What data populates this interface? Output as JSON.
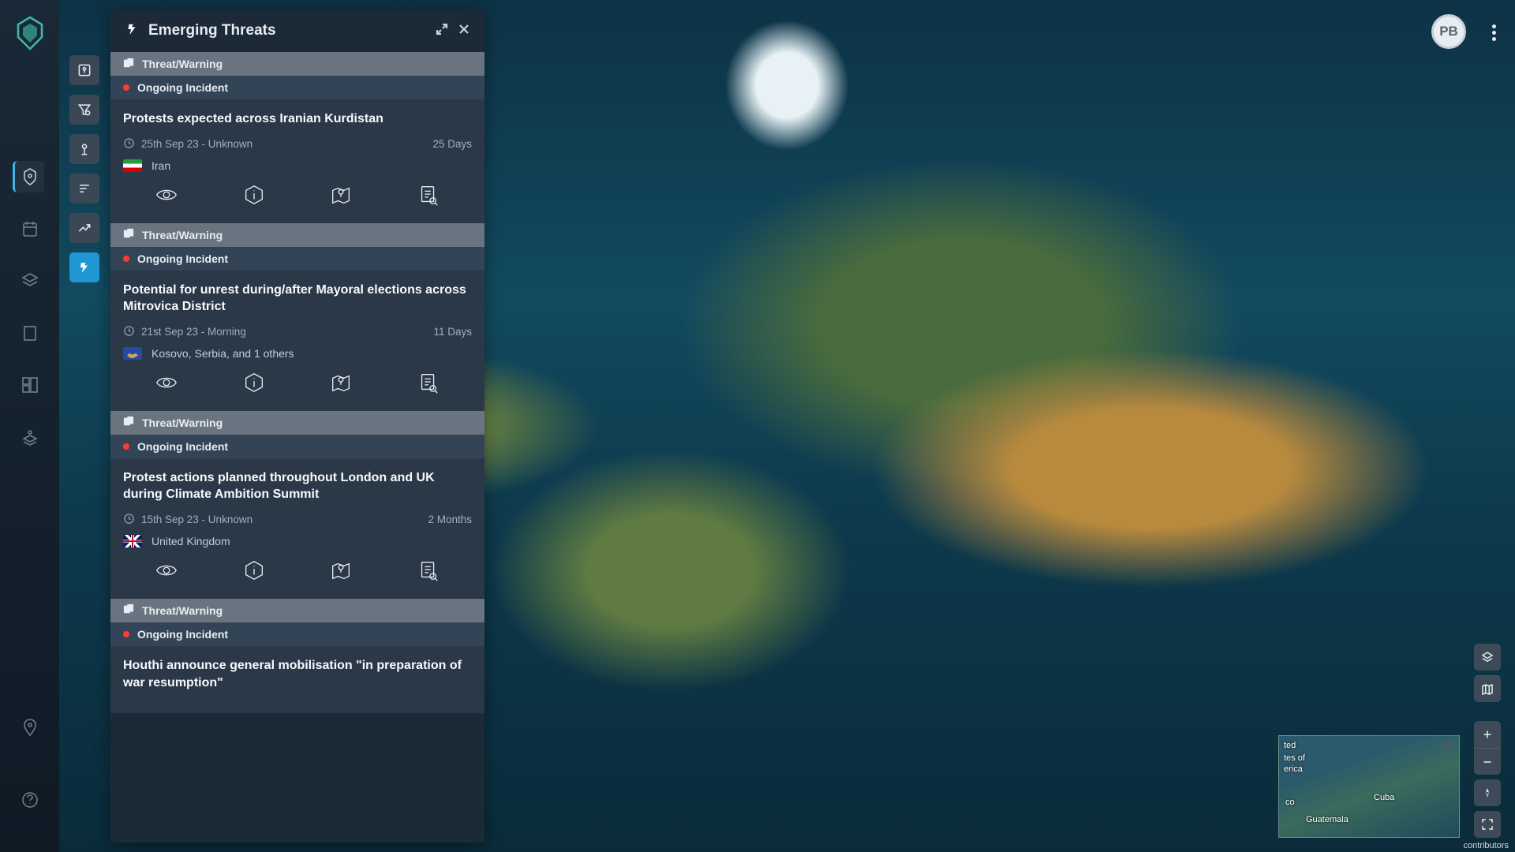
{
  "header": {
    "title": "Emerging Threats",
    "user_initials": "PB"
  },
  "minimap": {
    "labels": [
      "ted",
      "tes of",
      "erica",
      "co",
      "Cuba",
      "Guatemala"
    ]
  },
  "attribution": "contributors",
  "tool_rail": [
    "map-pin",
    "filter",
    "location-marker",
    "sort",
    "trend",
    "alert"
  ],
  "threats": [
    {
      "category": "Threat/Warning",
      "status": "Ongoing Incident",
      "title": "Protests expected across Iranian Kurdistan",
      "date": "25th Sep 23 - Unknown",
      "duration": "25 Days",
      "country": "Iran",
      "flag": "iran"
    },
    {
      "category": "Threat/Warning",
      "status": "Ongoing Incident",
      "title": "Potential for unrest during/after Mayoral elections across Mitrovica District",
      "date": "21st Sep 23 - Morning",
      "duration": "11 Days",
      "country": "Kosovo, Serbia, and 1 others",
      "flag": "kosovo"
    },
    {
      "category": "Threat/Warning",
      "status": "Ongoing Incident",
      "title": "Protest actions planned throughout London and UK during Climate Ambition Summit",
      "date": "15th Sep 23 - Unknown",
      "duration": "2 Months",
      "country": "United Kingdom",
      "flag": "uk"
    },
    {
      "category": "Threat/Warning",
      "status": "Ongoing Incident",
      "title": "Houthi announce general mobilisation \"in preparation of war resumption\"",
      "date": "",
      "duration": "",
      "country": "",
      "flag": ""
    }
  ]
}
